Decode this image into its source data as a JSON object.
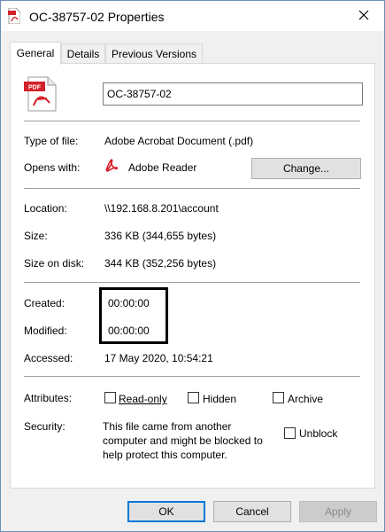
{
  "window": {
    "title": "OC-38757-02 Properties",
    "title_icon": "pdf-file-icon",
    "close_icon": "close-icon"
  },
  "tabs": [
    {
      "label": "General",
      "active": true
    },
    {
      "label": "Details",
      "active": false
    },
    {
      "label": "Previous Versions",
      "active": false
    }
  ],
  "general": {
    "file_icon": "pdf-document-icon",
    "file_icon_badge": "PDF",
    "file_name": "OC-38757-02",
    "type_label": "Type of file:",
    "type_value": "Adobe Acrobat Document (.pdf)",
    "opens_with_label": "Opens with:",
    "opens_with_value": "Adobe Reader",
    "opens_with_icon": "adobe-reader-icon",
    "change_button": "Change...",
    "location_label": "Location:",
    "location_value": "\\\\192.168.8.201\\account",
    "size_label": "Size:",
    "size_value": "336 KB (344,655 bytes)",
    "size_on_disk_label": "Size on disk:",
    "size_on_disk_value": "344 KB (352,256 bytes)",
    "created_label": "Created:",
    "created_value": "00:00:00",
    "modified_label": "Modified:",
    "modified_value": "00:00:00",
    "accessed_label": "Accessed:",
    "accessed_value": "17 May 2020, 10:54:21",
    "attributes_label": "Attributes:",
    "readonly_label": "Read-only",
    "readonly_checked": false,
    "hidden_label": "Hidden",
    "hidden_checked": false,
    "archive_label": "Archive",
    "archive_checked": false,
    "security_label": "Security:",
    "security_line1": "This file came from another",
    "security_line2": "computer and might be blocked to",
    "security_line3": "help protect this computer.",
    "unblock_label": "Unblock",
    "unblock_checked": false
  },
  "footer": {
    "ok": "OK",
    "cancel": "Cancel",
    "apply": "Apply"
  },
  "colors": {
    "accent": "#0078d7",
    "pdf_red": "#d4202a",
    "window_border": "#6c8fb6"
  }
}
